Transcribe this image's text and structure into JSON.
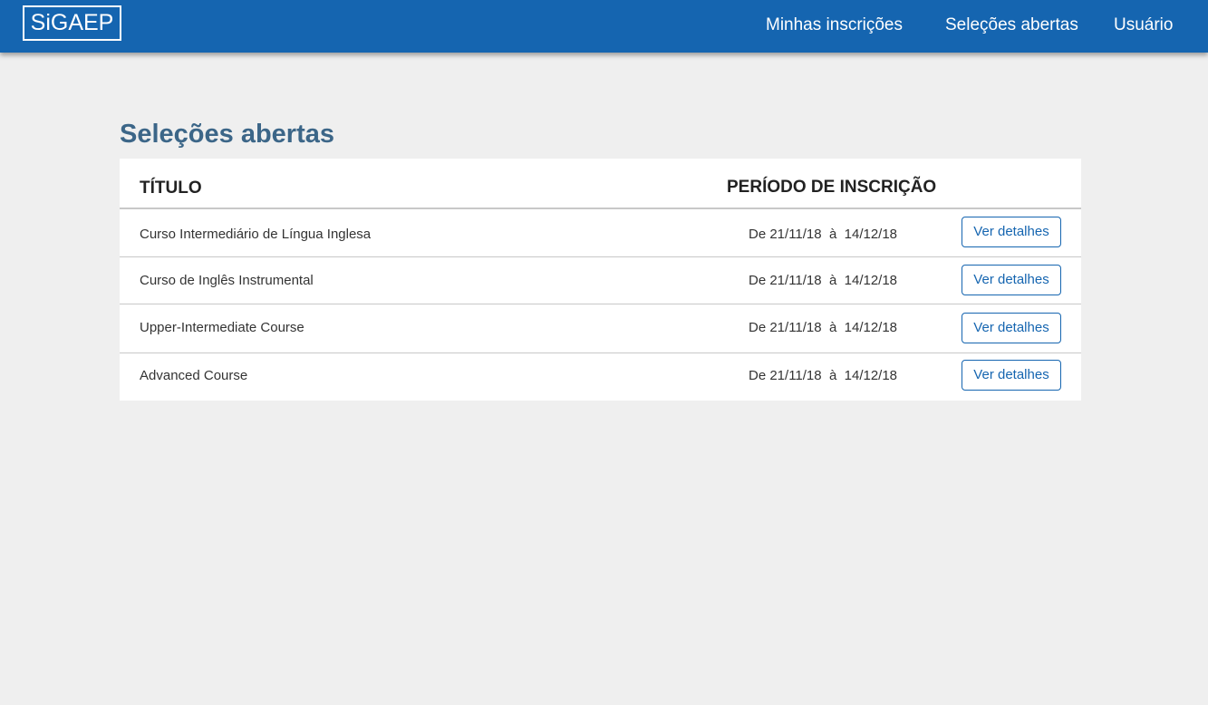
{
  "header": {
    "logo": "SiGAEP",
    "nav": {
      "my_registrations": "Minhas inscrições",
      "open_selections": "Seleções abertas",
      "user": "Usuário"
    }
  },
  "main": {
    "page_title": "Seleções abertas",
    "table": {
      "columns": {
        "title": "TÍTULO",
        "period": "PERÍODO DE INSCRIÇÃO"
      },
      "rows": [
        {
          "title": "Curso Intermediário de Língua Inglesa",
          "period": "De 21/11/18  à  14/12/18",
          "action": "Ver detalhes"
        },
        {
          "title": "Curso de Inglês Instrumental",
          "period": "De 21/11/18  à  14/12/18",
          "action": "Ver detalhes"
        },
        {
          "title": "Upper-Intermediate Course",
          "period": "De 21/11/18  à  14/12/18",
          "action": "Ver detalhes"
        },
        {
          "title": "Advanced Course",
          "period": "De 21/11/18  à  14/12/18",
          "action": "Ver detalhes"
        }
      ]
    }
  },
  "colors": {
    "navbar": "#1565b0",
    "background": "#efefef",
    "title": "#3c6688",
    "button": "#1565b0"
  }
}
